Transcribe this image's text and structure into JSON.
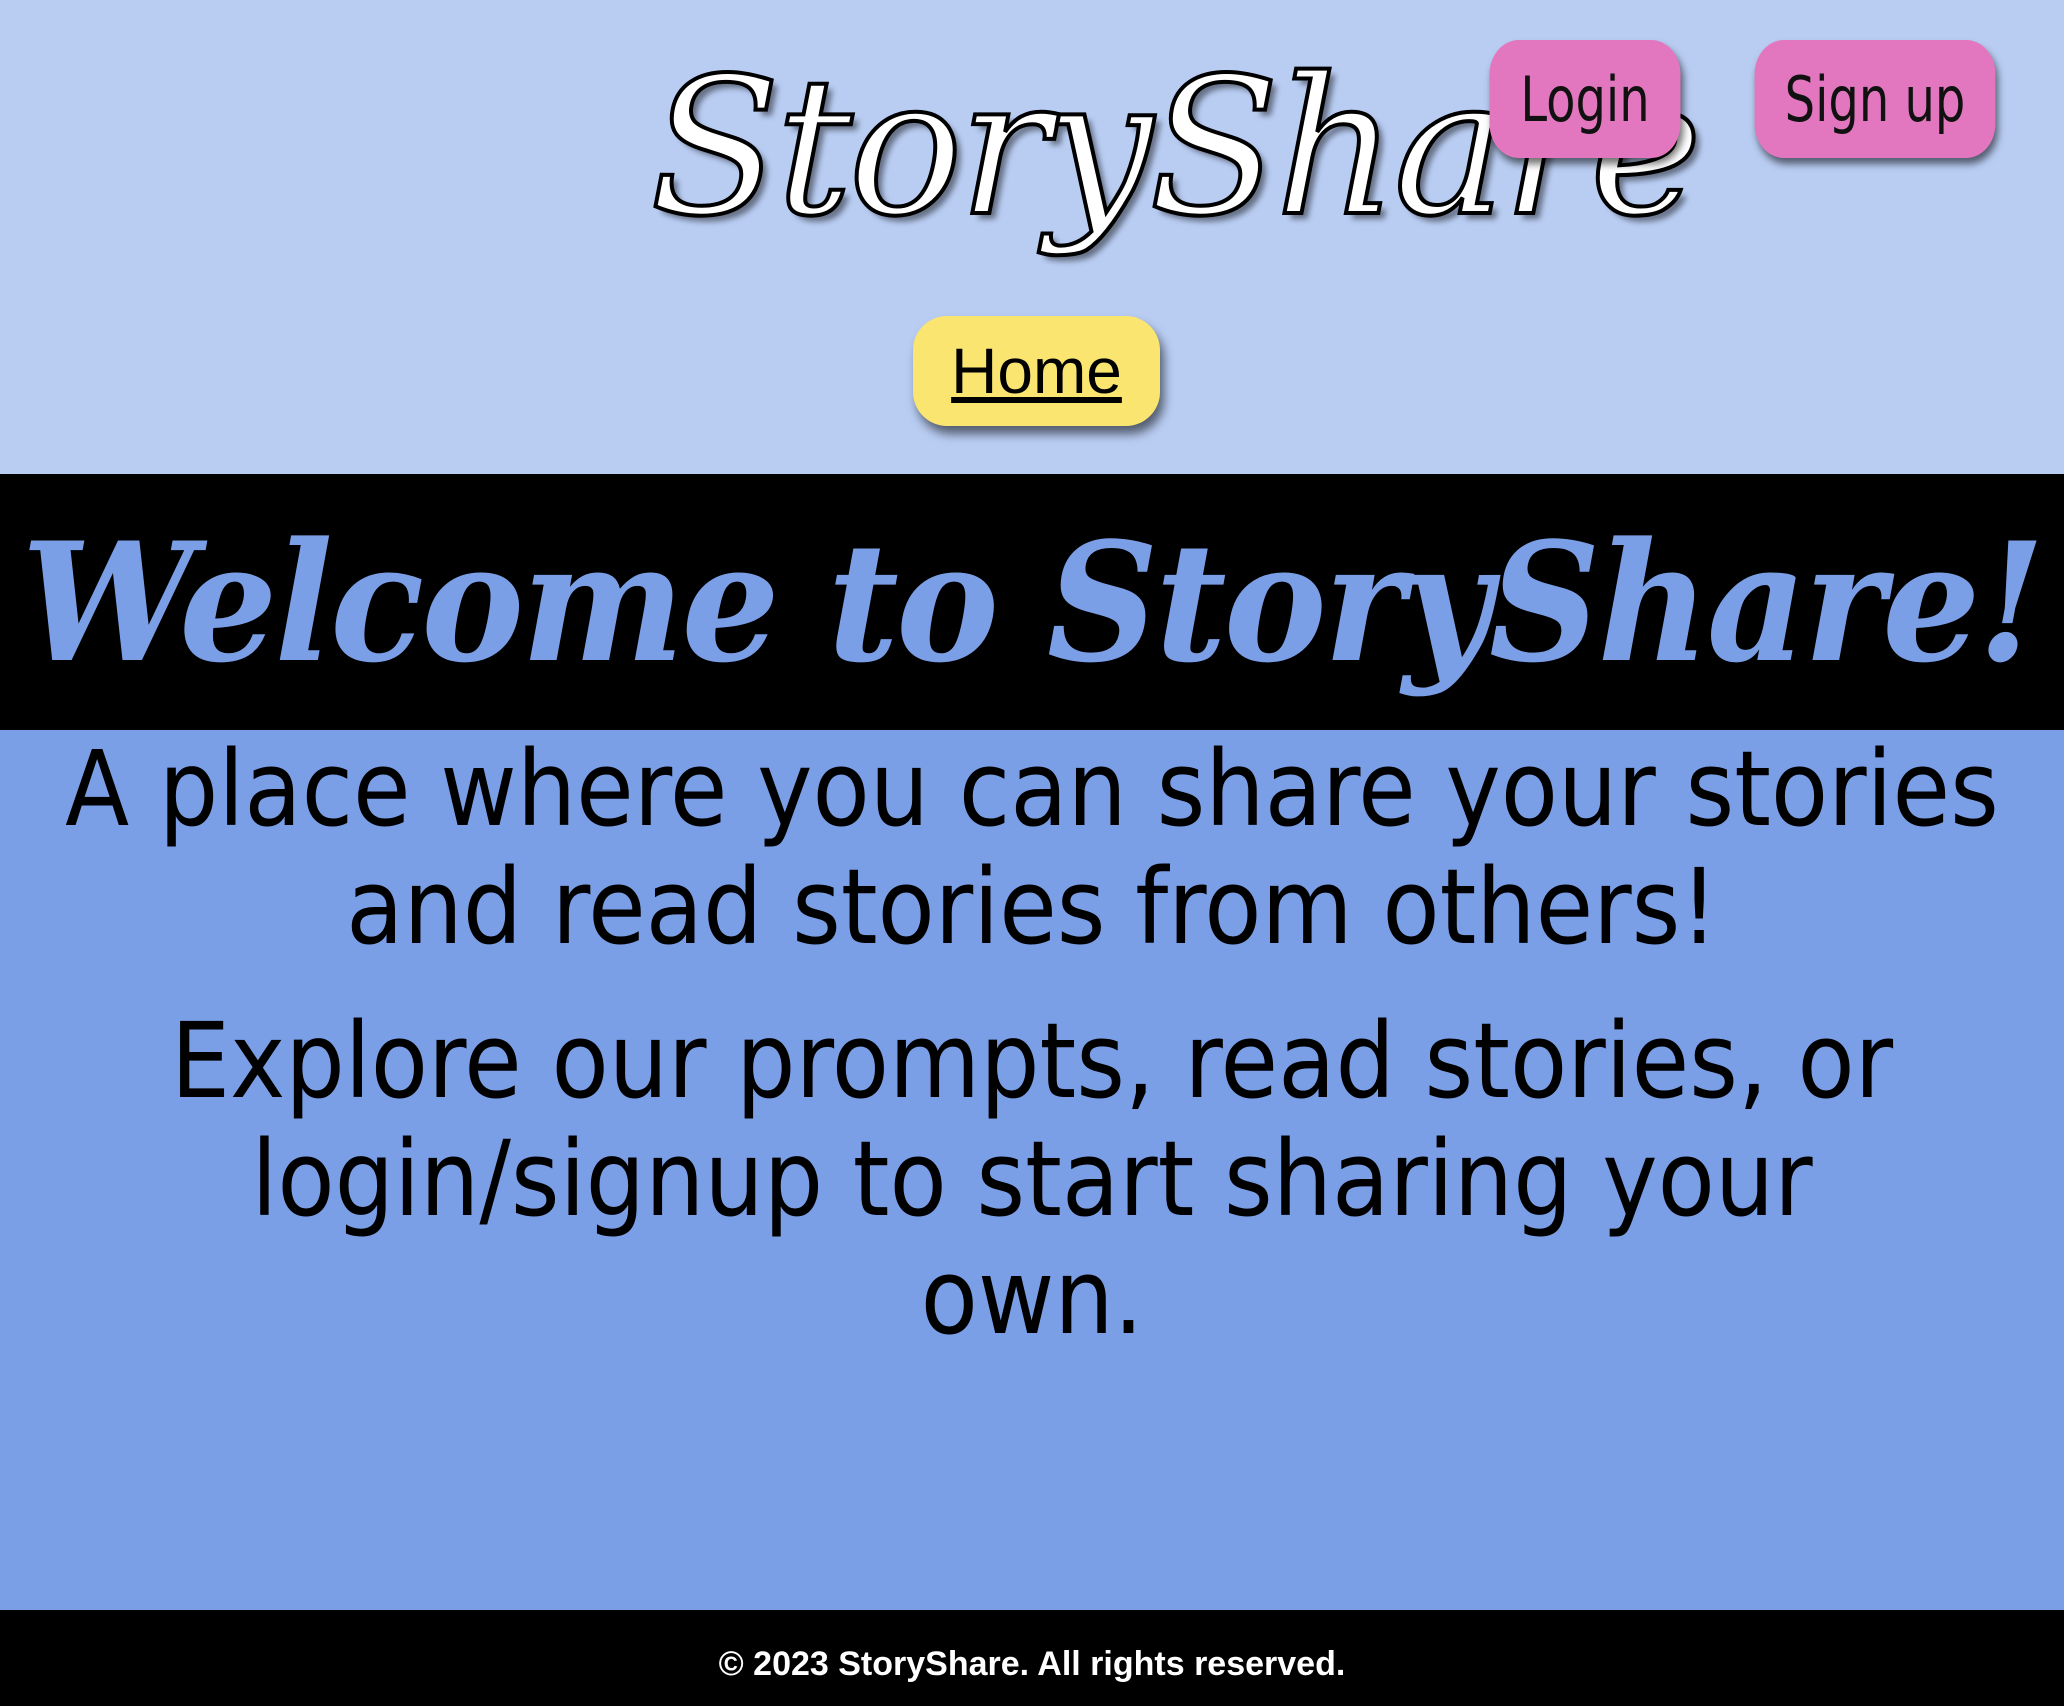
{
  "header": {
    "logo_text": "StoryShare",
    "login_label": "Login",
    "signup_label": "Sign up",
    "home_label": "Home"
  },
  "banner": {
    "title": "Welcome to StoryShare!"
  },
  "main": {
    "intro_line": "A place where you can share your stories and read stories from others!",
    "explore_line": "Explore our prompts, read stories, or login/signup to start sharing your own."
  },
  "footer": {
    "copyright": "© 2023 StoryShare. All rights reserved."
  },
  "colors": {
    "header_bg": "#b9cdf3",
    "main_bg": "#7b9fe6",
    "auth_button": "#e277bf",
    "home_button": "#f9e56f",
    "banner_bg": "#000000",
    "banner_text": "#7b9fe6"
  }
}
